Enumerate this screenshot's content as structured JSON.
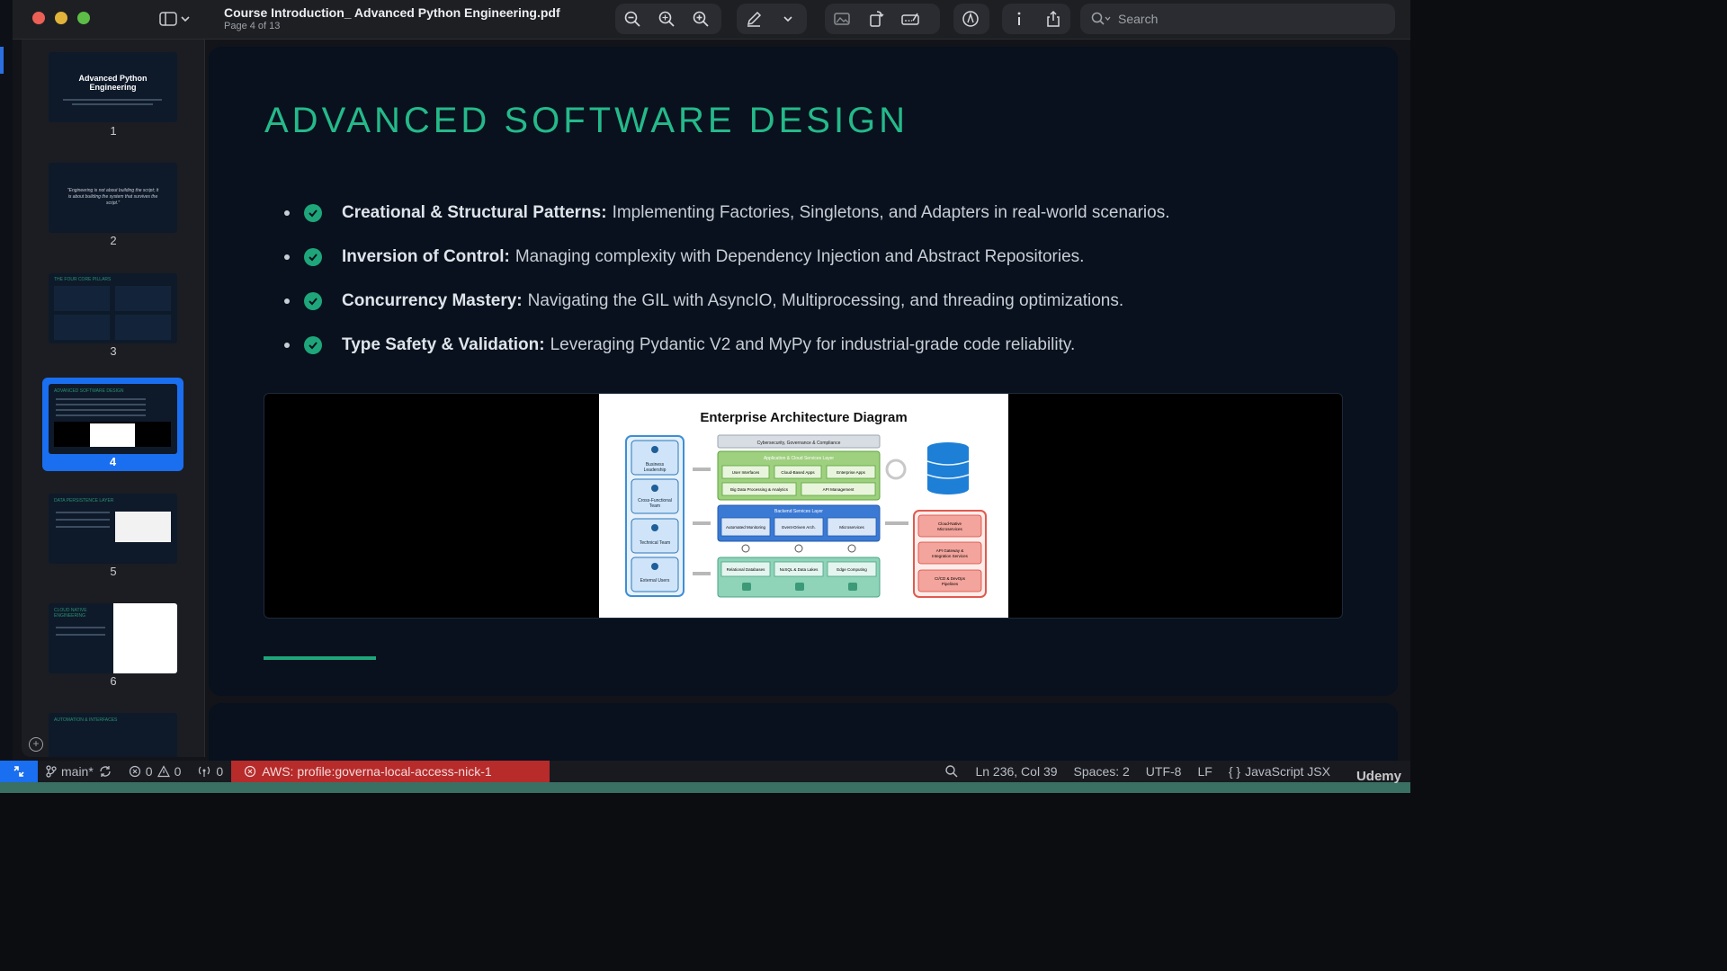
{
  "titlebar": {
    "doc_title": "Course Introduction_ Advanced Python Engineering.pdf",
    "doc_subtitle": "Page 4 of 13",
    "search_placeholder": "Search"
  },
  "thumbnails": [
    {
      "num": "1",
      "title": "Advanced Python Engineering"
    },
    {
      "num": "2",
      "quote": "\"Engineering is not about building the script; it is about building the system that survives the script.\""
    },
    {
      "num": "3",
      "title": "THE FOUR CORE PILLARS"
    },
    {
      "num": "4",
      "title": "ADVANCED SOFTWARE DESIGN"
    },
    {
      "num": "5",
      "title": "DATA PERSISTENCE LAYER"
    },
    {
      "num": "6",
      "title": "CLOUD NATIVE ENGINEERING"
    },
    {
      "num": "7",
      "title": "AUTOMATION & INTERFACES"
    }
  ],
  "slide": {
    "title": "ADVANCED SOFTWARE DESIGN",
    "bullets": [
      {
        "bold": "Creational & Structural Patterns:",
        "text": "Implementing Factories, Singletons, and Adapters in real-world scenarios."
      },
      {
        "bold": "Inversion of Control:",
        "text": "Managing complexity with Dependency Injection and Abstract Repositories."
      },
      {
        "bold": "Concurrency Mastery:",
        "text": "Navigating the GIL with AsyncIO, Multiprocessing, and threading optimizations."
      },
      {
        "bold": "Type Safety & Validation:",
        "text": "Leveraging Pydantic V2 and MyPy for industrial-grade code reliability."
      }
    ],
    "diagram": {
      "title": "Enterprise Architecture Diagram",
      "actors": [
        "Business Leadership",
        "Cross-Functional Team",
        "Technical Team",
        "External Users"
      ],
      "top_bar": "Cybersecurity, Governance & Compliance",
      "app_layer": {
        "title": "Application & Cloud Services Layer",
        "items": [
          "User Interfaces",
          "Cloud-Based Applications",
          "Enterprise Applications",
          "Big Data Processing & Analytics",
          "API Management"
        ]
      },
      "backend_layer": {
        "title": "Backend Services Layer",
        "items": [
          "Automated Monitoring",
          "Event-Driven Architecture",
          "Microservices & Serverless Computing"
        ]
      },
      "data_layer": {
        "items": [
          "Relational Databases",
          "NoSQL & Data Lakes",
          "Edge Computing"
        ]
      },
      "right_items": [
        "Cloud-Native Microservices",
        "API Gateway & Integration Services",
        "CI/CD & DevOps Pipelines"
      ]
    }
  },
  "statusbar": {
    "branch": "main*",
    "errors": "0",
    "warnings": "0",
    "ports": "0",
    "aws": "AWS: profile:governa-local-access-nick-1",
    "position": "Ln 236, Col 39",
    "spaces": "Spaces: 2",
    "encoding": "UTF-8",
    "eol": "LF",
    "language": "JavaScript JSX"
  },
  "watermark": "Udemy",
  "colors": {
    "accent_green": "#25b98a",
    "selection_blue": "#1a6ef0",
    "aws_red": "#b72b2b"
  }
}
